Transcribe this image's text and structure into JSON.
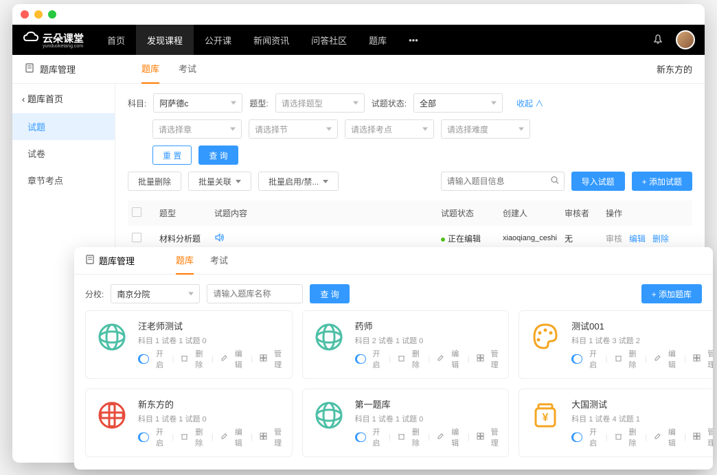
{
  "topnav": {
    "logo_text": "云朵课堂",
    "logo_sub": "yunduoketang.com",
    "items": [
      "首页",
      "发现课程",
      "公开课",
      "新闻资讯",
      "问答社区",
      "题库"
    ],
    "active_index": 1
  },
  "win1": {
    "title": "题库管理",
    "tabs": [
      "题库",
      "考试"
    ],
    "active_tab": 0,
    "right_text": "新东方的",
    "sidebar": {
      "back": "题库首页",
      "items": [
        "试题",
        "试卷",
        "章节考点"
      ],
      "active_index": 0
    },
    "filters": {
      "subject_label": "科目:",
      "subject_value": "阿萨德c",
      "type_label": "题型:",
      "type_placeholder": "请选择题型",
      "status_label": "试题状态:",
      "status_value": "全部",
      "collapse": "收起",
      "chapter_placeholder": "请选择章",
      "section_placeholder": "请选择节",
      "point_placeholder": "请选择考点",
      "difficulty_placeholder": "请选择难度",
      "reset": "重 置",
      "query": "查 询"
    },
    "toolbar": {
      "bulk_delete": "批量删除",
      "bulk_link": "批量关联",
      "bulk_toggle": "批量启用/禁...",
      "search_placeholder": "请输入题目信息",
      "import": "导入试题",
      "add": "+ 添加试题"
    },
    "table": {
      "headers": {
        "type": "题型",
        "content": "试题内容",
        "status": "试题状态",
        "creator": "创建人",
        "reviewer": "审核者",
        "ops": "操作"
      },
      "rows": [
        {
          "type": "材料分析题",
          "content_icon": "audio",
          "status": "正在编辑",
          "creator": "xiaoqiang_ceshi",
          "reviewer": "无",
          "op_review": "审核",
          "op_edit": "编辑",
          "op_delete": "删除"
        }
      ]
    }
  },
  "win2": {
    "title": "题库管理",
    "tabs": [
      "题库",
      "考试"
    ],
    "active_tab": 0,
    "filter": {
      "school_label": "分校:",
      "school_value": "南京分院",
      "name_placeholder": "请输入题库名称",
      "query": "查 询",
      "add": "+ 添加题库"
    },
    "ops": {
      "toggle": "开启",
      "delete": "删除",
      "edit": "编辑",
      "manage": "管理"
    },
    "cards": [
      {
        "title": "汪老师测试",
        "icon": "globe-teal",
        "meta": [
          "科目 1",
          "试卷 1",
          "试题 0"
        ]
      },
      {
        "title": "药师",
        "icon": "globe-teal",
        "meta": [
          "科目 2",
          "试卷 1",
          "试题 0"
        ]
      },
      {
        "title": "测试001",
        "icon": "palette",
        "meta": [
          "科目 1",
          "试卷 3",
          "试题 2"
        ]
      },
      {
        "title": "新东方的",
        "icon": "coin-red",
        "meta": [
          "科目 1",
          "试卷 1",
          "试题 0"
        ]
      },
      {
        "title": "第一题库",
        "icon": "globe-teal",
        "meta": [
          "科目 1",
          "试卷 1",
          "试题 0"
        ]
      },
      {
        "title": "大国测试",
        "icon": "jar-orange",
        "meta": [
          "科目 1",
          "试卷 4",
          "试题 1"
        ]
      }
    ]
  }
}
